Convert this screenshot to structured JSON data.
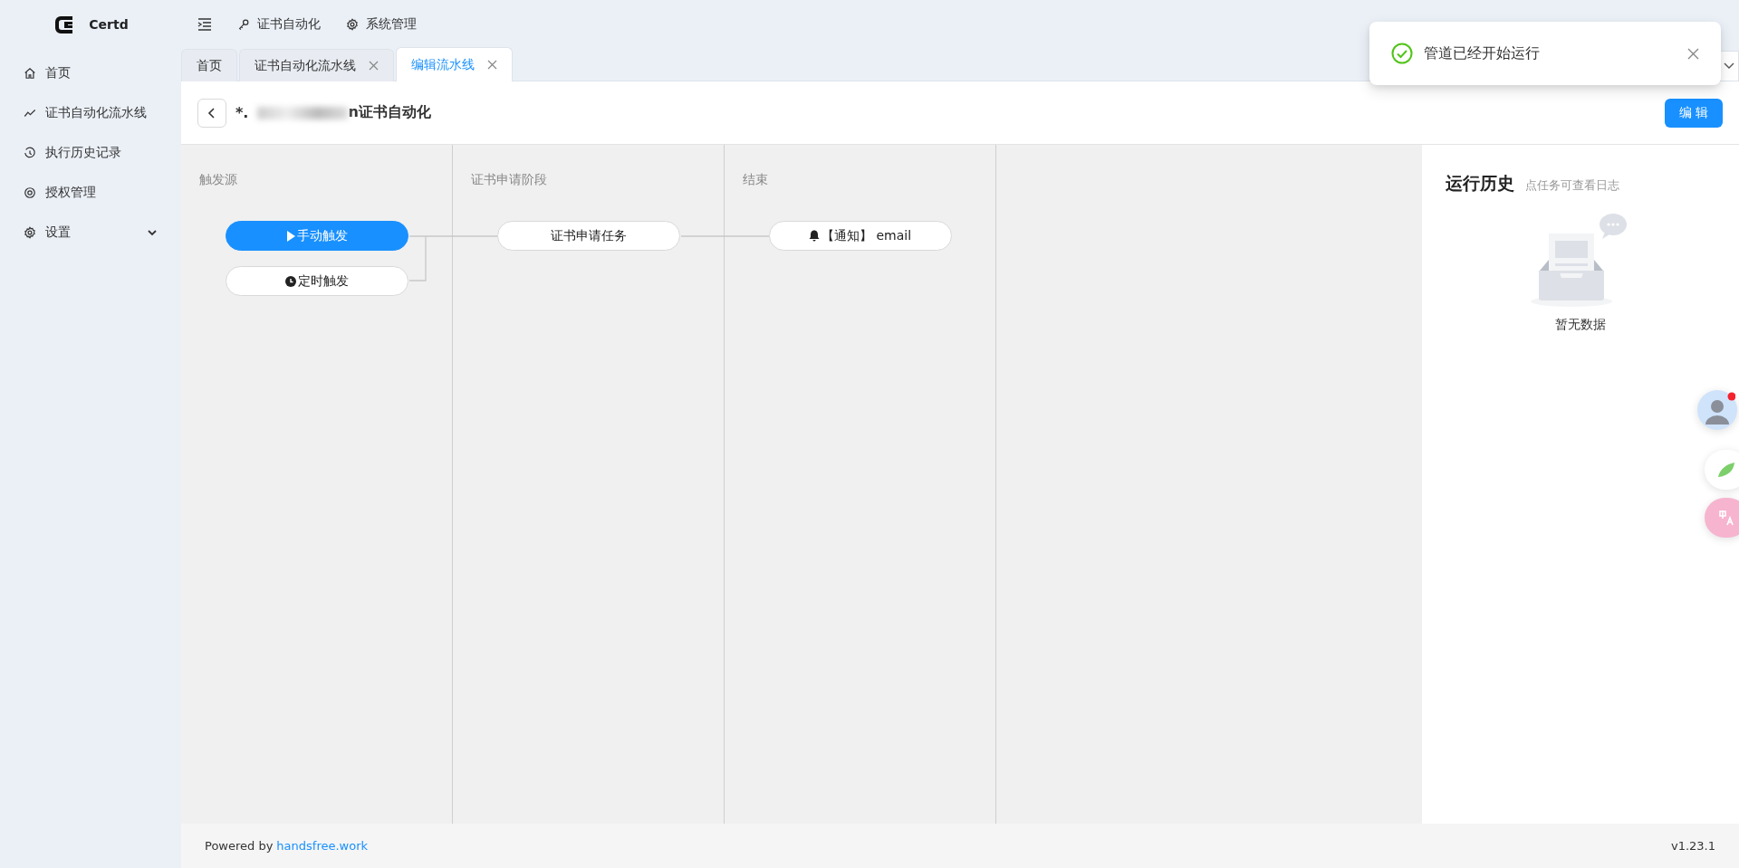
{
  "brand": {
    "name": "Certd"
  },
  "header": {
    "menu": [
      {
        "label": "证书自动化"
      },
      {
        "label": "系统管理"
      }
    ]
  },
  "sidebar": {
    "items": [
      {
        "label": "首页",
        "expandable": false
      },
      {
        "label": "证书自动化流水线",
        "expandable": false
      },
      {
        "label": "执行历史记录",
        "expandable": false
      },
      {
        "label": "授权管理",
        "expandable": false
      },
      {
        "label": "设置",
        "expandable": true
      }
    ]
  },
  "tabs": [
    {
      "label": "首页",
      "selected": false,
      "closable": false
    },
    {
      "label": "证书自动化流水线",
      "selected": false,
      "closable": true
    },
    {
      "label": "编辑流水线",
      "selected": true,
      "closable": true
    }
  ],
  "page": {
    "title_prefix": "*.",
    "title": "n证书自动化",
    "edit_button": "编 辑"
  },
  "stages": [
    {
      "title": "触发源",
      "tasks": [
        {
          "label": "手动触发",
          "kind": "manual",
          "highlighted": true
        },
        {
          "label": "定时触发",
          "kind": "timer",
          "highlighted": false
        }
      ]
    },
    {
      "title": "证书申请阶段",
      "tasks": [
        {
          "label": "证书申请任务",
          "kind": "task",
          "highlighted": false
        }
      ]
    },
    {
      "title": "结束",
      "tasks": [
        {
          "label": "【通知】 email",
          "kind": "notify",
          "highlighted": false
        }
      ]
    }
  ],
  "history": {
    "title": "运行历史",
    "hint": "点任务可查看日志",
    "empty": "暂无数据"
  },
  "footer": {
    "powered": "Powered by",
    "link": "handsfree.work",
    "version": "v1.23.1"
  },
  "toast": {
    "kind": "success",
    "message": "管道已经开始运行"
  }
}
